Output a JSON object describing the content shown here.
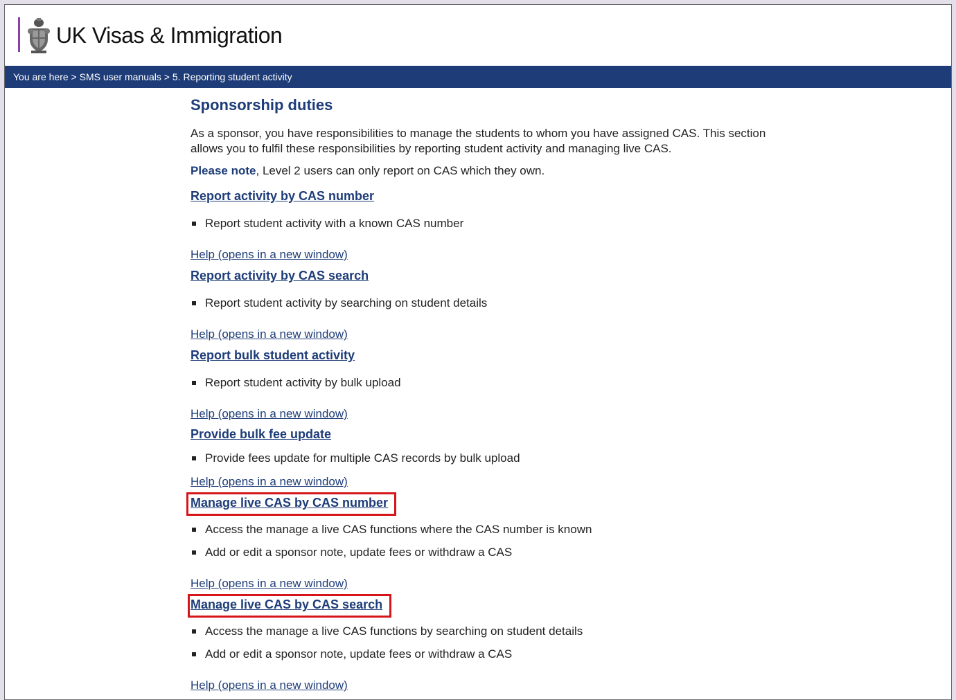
{
  "header": {
    "brand": "UK Visas & Immigration",
    "crest_icon": "royal-crest-icon"
  },
  "breadcrumb": {
    "prefix": "You are here",
    "sep": " > ",
    "items": [
      "SMS user manuals",
      "5. Reporting student activity"
    ]
  },
  "main": {
    "title": "Sponsorship duties",
    "intro": "As a sponsor, you have responsibilities to manage the students to whom you have assigned CAS. This section allows you to fulfil these responsibilities by reporting student activity and managing live CAS.",
    "note_label": "Please note",
    "note_text": ", Level 2 users can only report on CAS which they own.",
    "help_label": "Help (opens in a new window)",
    "sections": [
      {
        "title": "Report activity by CAS number",
        "bullets": [
          "Report student activity with a known CAS number"
        ]
      },
      {
        "title": "Report activity by CAS search",
        "bullets": [
          "Report student activity by searching on student details"
        ]
      },
      {
        "title": "Report bulk student activity",
        "bullets": [
          "Report student activity by bulk upload"
        ]
      },
      {
        "title": "Provide bulk fee update",
        "bullets": [
          "Provide fees update for multiple CAS records by bulk upload"
        ]
      },
      {
        "title": "Manage live CAS by CAS number",
        "bullets": [
          "Access the manage a live CAS functions where the CAS number is known",
          "Add or edit a sponsor note, update fees or withdraw a CAS"
        ]
      },
      {
        "title": "Manage live CAS by CAS search",
        "bullets": [
          "Access the manage a live CAS functions by searching on student details",
          "Add or edit a sponsor note, update fees or withdraw a CAS"
        ]
      }
    ]
  },
  "colors": {
    "navy": "#1d3c78",
    "highlight": "#d6151b",
    "accent_bar": "#8b3fa8"
  }
}
